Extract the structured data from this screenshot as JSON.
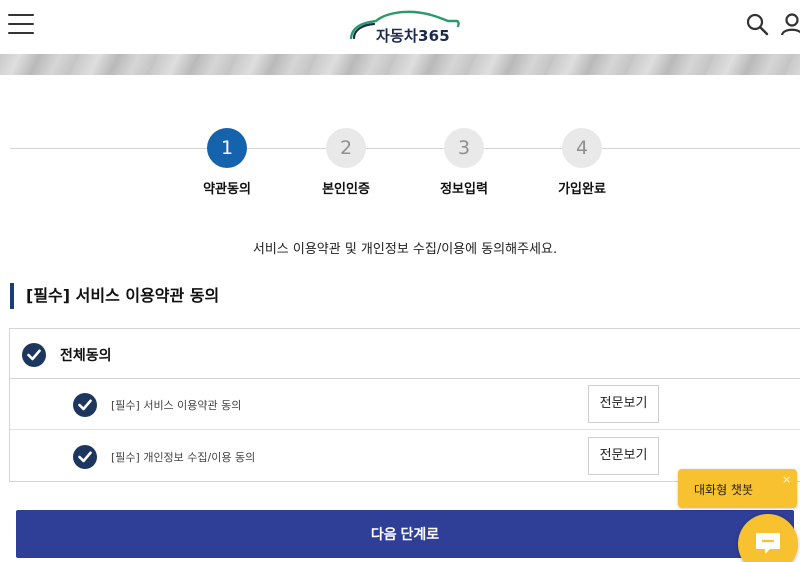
{
  "header": {
    "logo_text": "자동차365",
    "menu_icon": "hamburger-menu-icon",
    "search_icon": "search-icon",
    "user_icon": "user-icon"
  },
  "steps": [
    {
      "number": "1",
      "label": "약관동의",
      "active": true
    },
    {
      "number": "2",
      "label": "본인인증",
      "active": false
    },
    {
      "number": "3",
      "label": "정보입력",
      "active": false
    },
    {
      "number": "4",
      "label": "가입완료",
      "active": false
    }
  ],
  "guide_text": "서비스 이용약관 및 개인정보 수집/이용에 동의해주세요.",
  "section_title": "[필수] 서비스 이용약관 동의",
  "agreements": {
    "all_label": "전체동의",
    "items": [
      {
        "label": "[필수] 서비스 이용약관 동의",
        "button": "전문보기"
      },
      {
        "label": "[필수] 개인정보 수집/이용 동의",
        "button": "전문보기"
      }
    ]
  },
  "next_button": "다음 단계로",
  "chatbot": {
    "label": "대화형 챗봇",
    "close": "×"
  },
  "colors": {
    "primary": "#2f3e97",
    "step_active": "#1663ad",
    "check": "#1c365e",
    "chat": "#f8c12f"
  }
}
